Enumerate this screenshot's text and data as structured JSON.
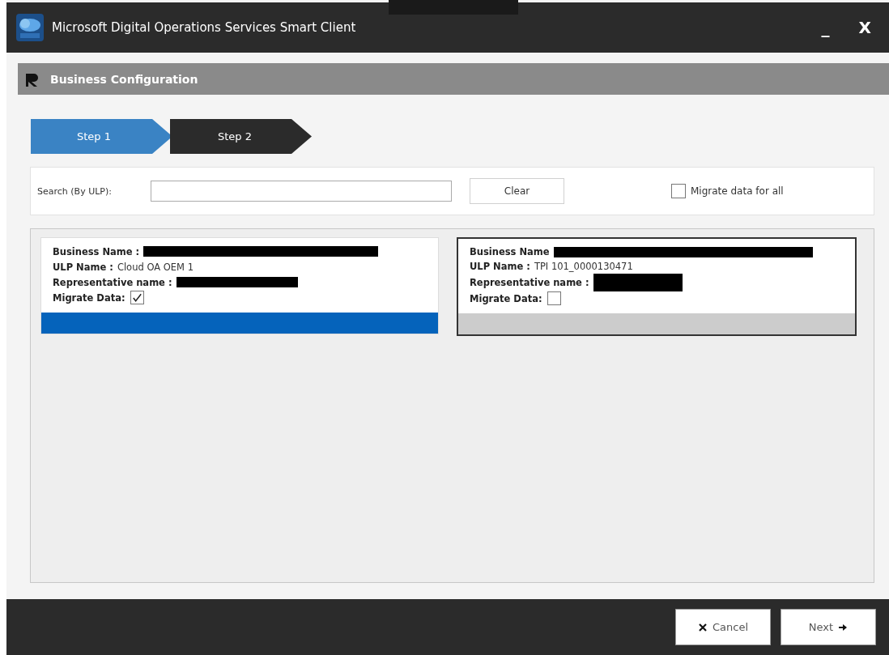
{
  "window": {
    "title": "Microsoft Digital Operations Services Smart Client",
    "minimize": "_",
    "close": "X"
  },
  "header": {
    "title": "Business Configuration"
  },
  "steps": [
    {
      "label": "Step 1",
      "selected": true
    },
    {
      "label": "Step 2",
      "selected": false
    }
  ],
  "search": {
    "label": "Search (By ULP):",
    "clear": "Clear",
    "migrate_all": {
      "label": "Migrate data for all",
      "checked": false
    }
  },
  "cards": [
    {
      "business_label": "Business Name :",
      "ulp_label": "ULP Name :",
      "ulp_value": "Cloud OA OEM 1",
      "rep_label": "Representative name :",
      "migrate_label": "Migrate Data:",
      "migrate": true,
      "selected": true
    },
    {
      "business_label": "Business Name",
      "ulp_label": "ULP Name :",
      "ulp_value": "TPI 101_0000130471",
      "rep_label": "Representative name :",
      "migrate_label": "Migrate Data:",
      "migrate": false,
      "selected": false
    }
  ],
  "footer": {
    "cancel": "Cancel",
    "next": "Next"
  }
}
